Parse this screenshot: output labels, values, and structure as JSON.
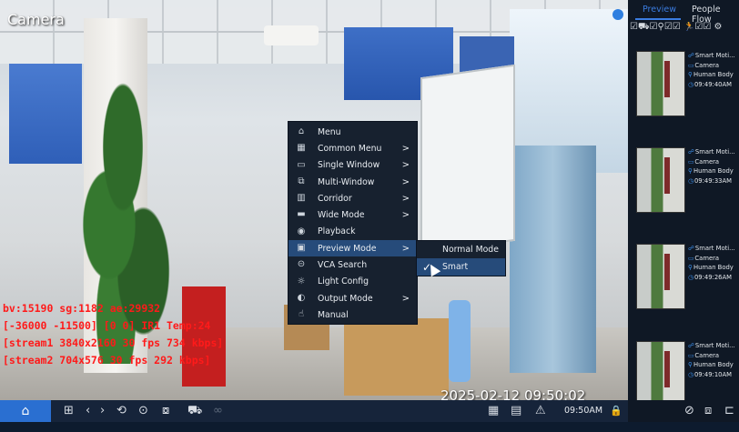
{
  "camera": {
    "title": "Camera",
    "timestamp": "2025-02-12 09:50:02",
    "debug_lines": [
      "bv:15190 sg:1182 ae:29932",
      "[-36000 -11500] [0 0] IR1 Temp:24",
      "[stream1 3840x2160 30 fps 734 kbps]",
      "[stream2 704x576 30 fps 292 kbps]"
    ],
    "debug_color": "#ff1a1a"
  },
  "context_menu": {
    "items": [
      {
        "icon": "home-icon",
        "glyph": "⌂",
        "label": "Menu",
        "submenu": false
      },
      {
        "icon": "grid-icon",
        "glyph": "▦",
        "label": "Common Menu",
        "submenu": true
      },
      {
        "icon": "single-window-icon",
        "glyph": "▭",
        "label": "Single Window",
        "submenu": true
      },
      {
        "icon": "multi-window-icon",
        "glyph": "⧉",
        "label": "Multi-Window",
        "submenu": true
      },
      {
        "icon": "corridor-icon",
        "glyph": "▥",
        "label": "Corridor",
        "submenu": true
      },
      {
        "icon": "wide-mode-icon",
        "glyph": "▬",
        "label": "Wide Mode",
        "submenu": true
      },
      {
        "icon": "playback-icon",
        "glyph": "◉",
        "label": "Playback",
        "submenu": false
      },
      {
        "icon": "preview-mode-icon",
        "glyph": "▣",
        "label": "Preview Mode",
        "submenu": true,
        "selected": true
      },
      {
        "icon": "vca-search-icon",
        "glyph": "⊝",
        "label": "VCA Search",
        "submenu": false
      },
      {
        "icon": "light-config-icon",
        "glyph": "☼",
        "label": "Light Config",
        "submenu": false
      },
      {
        "icon": "output-mode-icon",
        "glyph": "◐",
        "label": "Output Mode",
        "submenu": true
      },
      {
        "icon": "manual-icon",
        "glyph": "☝",
        "label": "Manual",
        "submenu": false
      }
    ],
    "arrow": ">",
    "highlight_color": "#264b7a"
  },
  "preview_submenu": {
    "items": [
      {
        "label": "Normal Mode",
        "checked": false
      },
      {
        "label": "Smart",
        "checked": true
      }
    ],
    "check": "✓"
  },
  "panel": {
    "tabs": [
      {
        "label": "Preview",
        "active": true
      },
      {
        "label": "People Flow",
        "active": false
      }
    ],
    "filters": "☑⛟☑⚲☑☑ 🏃☑☑ ⚙",
    "events": [
      {
        "type": "Smart Moti...",
        "camera": "Camera",
        "target": "Human Body",
        "time": "09:49:40AM"
      },
      {
        "type": "Smart Moti...",
        "camera": "Camera",
        "target": "Human Body",
        "time": "09:49:33AM"
      },
      {
        "type": "Smart Moti...",
        "camera": "Camera",
        "target": "Human Body",
        "time": "09:49:26AM"
      },
      {
        "type": "Smart Moti...",
        "camera": "Camera",
        "target": "Human Body",
        "time": "09:49:10AM"
      }
    ],
    "accent": "#3b7ce0"
  },
  "taskbar": {
    "home_glyph": "⌂",
    "icons": [
      {
        "name": "layout-grid-icon",
        "glyph": "⊞"
      },
      {
        "name": "prev-icon",
        "glyph": "‹"
      },
      {
        "name": "next-icon",
        "glyph": "›"
      },
      {
        "name": "sequence-icon",
        "glyph": "⟲"
      },
      {
        "name": "playback-icon",
        "glyph": "⊙"
      },
      {
        "name": "snapshot-icon",
        "glyph": "⧇"
      },
      {
        "name": "vehicle-icon",
        "glyph": "⛟"
      },
      {
        "name": "vr-icon",
        "glyph": "∞"
      }
    ],
    "right_icons": [
      {
        "name": "qr-code-icon",
        "glyph": "▦"
      },
      {
        "name": "document-icon",
        "glyph": "▤"
      },
      {
        "name": "warning-icon",
        "glyph": "⚠"
      }
    ],
    "clock": "09:50AM",
    "lock_glyph": "🔒",
    "panel_icons": [
      "⊘",
      "⧈",
      "⊏"
    ]
  }
}
